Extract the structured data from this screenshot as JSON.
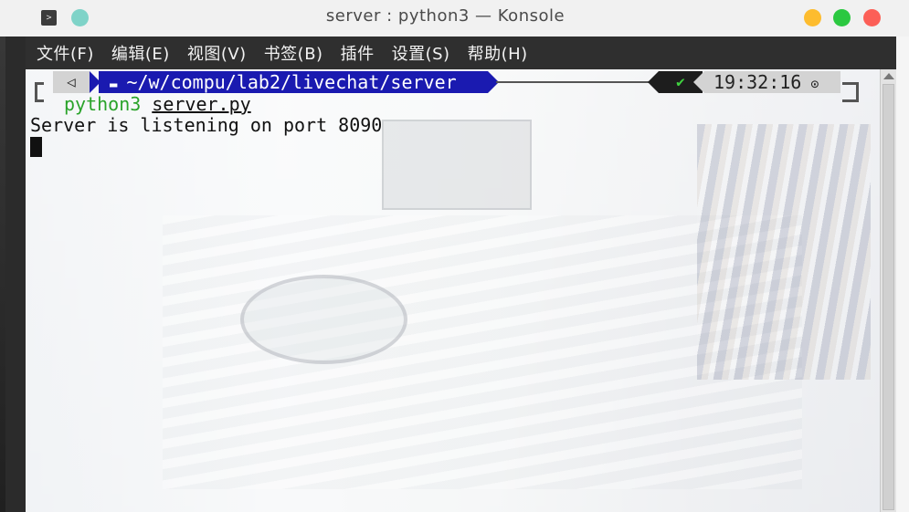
{
  "window": {
    "title": "server : python3 — Konsole",
    "app_icon": "terminal-icon"
  },
  "menubar": {
    "items": [
      "文件(F)",
      "编辑(E)",
      "视图(V)",
      "书签(B)",
      "插件",
      "设置(S)",
      "帮助(H)"
    ]
  },
  "prompt": {
    "os_icon": "◁",
    "folder_icon": "▬",
    "path": "~/w/compu/lab2/livechat/server",
    "status_icon": "✔",
    "time": "19:32:16",
    "clock_icon": "⊙"
  },
  "terminal": {
    "command": "python3",
    "argument": "server.py",
    "output": "Server is listening on port 8090"
  },
  "colors": {
    "dir_segment": "#1a1ab0",
    "command_green": "#2aa32a",
    "status_ok": "#3fd23f",
    "close": "#fc5f57",
    "minimize": "#fdbc2e",
    "maximize": "#2bc840"
  }
}
